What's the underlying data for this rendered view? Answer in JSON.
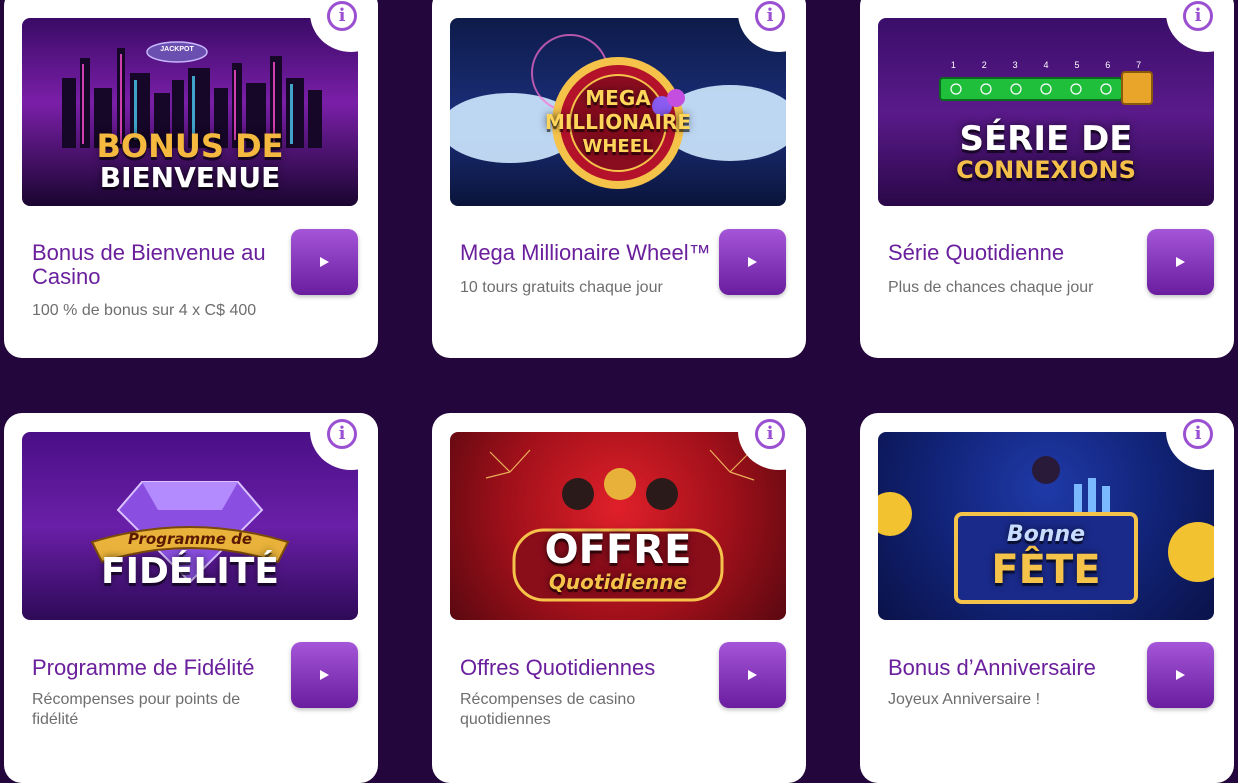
{
  "colors": {
    "page_background": "#23073c",
    "title": "#6a1f9c",
    "subtitle": "#6e6e6e",
    "button_top": "#a455d8",
    "button_bottom": "#6a1d9e",
    "info_icon": "#9b4fd1"
  },
  "promotions": [
    {
      "id": "bienvenue",
      "title": "Bonus de Bienvenue au Casino",
      "subtitle": "100 % de bonus sur 4 x C$ 400",
      "banner": {
        "line1": "BONUS DE",
        "line2": "BIENVENUE",
        "blimp": "JACKPOT"
      },
      "play_icon": "play-icon",
      "info_icon": "info-icon"
    },
    {
      "id": "mega-wheel",
      "title": "Mega Millionaire Wheel™",
      "subtitle": "10 tours gratuits chaque jour",
      "banner": {
        "line1": "MEGA",
        "line2": "MILLIONAIRE",
        "line3": "WHEEL"
      },
      "play_icon": "play-icon",
      "info_icon": "info-icon"
    },
    {
      "id": "serie",
      "title": "Série Quotidienne",
      "subtitle": "Plus de chances chaque jour",
      "banner": {
        "line1": "SÉRIE DE",
        "line2": "CONNEXIONS",
        "days": [
          "1",
          "2",
          "3",
          "4",
          "5",
          "6",
          "7"
        ]
      },
      "play_icon": "play-icon",
      "info_icon": "info-icon"
    },
    {
      "id": "fidelite",
      "title": "Programme de Fidélité",
      "subtitle": "Récompenses pour points de fidélité",
      "banner": {
        "line1": "Programme de",
        "line2": "FIDÉLITÉ"
      },
      "play_icon": "play-icon",
      "info_icon": "info-icon"
    },
    {
      "id": "offres",
      "title": "Offres Quotidiennes",
      "subtitle": "Récompenses de casino quotidiennes",
      "banner": {
        "line1": "OFFRE",
        "line2": "Quotidienne"
      },
      "play_icon": "play-icon",
      "info_icon": "info-icon"
    },
    {
      "id": "anniversaire",
      "title": "Bonus d’Anniversaire",
      "subtitle": "Joyeux Anniversaire !",
      "banner": {
        "line1": "Bonne",
        "line2": "FÊTE"
      },
      "play_icon": "play-icon",
      "info_icon": "info-icon"
    }
  ]
}
